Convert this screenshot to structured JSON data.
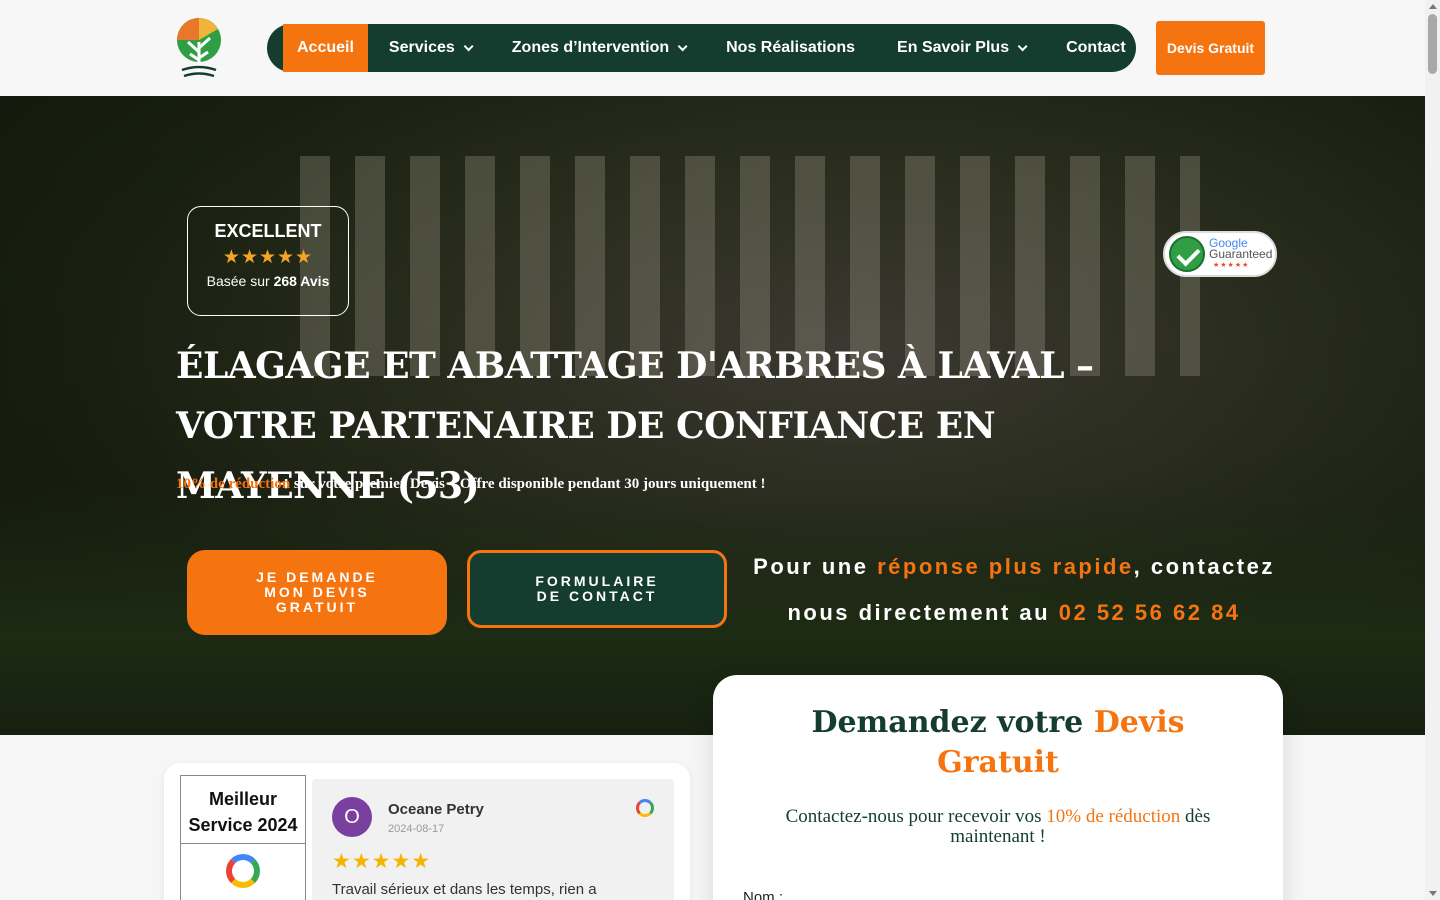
{
  "header": {
    "nav": [
      {
        "label": "Accueil",
        "active": true,
        "dropdown": false
      },
      {
        "label": "Services",
        "dropdown": true
      },
      {
        "label": "Zones d’Intervention",
        "dropdown": true
      },
      {
        "label": "Nos Réalisations",
        "dropdown": false
      },
      {
        "label": "En Savoir Plus",
        "dropdown": true
      },
      {
        "label": "Contact",
        "dropdown": false
      }
    ],
    "devis_button": "Devis Gratuit"
  },
  "hero": {
    "rating": {
      "label": "EXCELLENT",
      "stars": "★★★★★",
      "based_prefix": "Basée sur",
      "based_count": "268 Avis"
    },
    "google_badge": {
      "line1": "Google",
      "line2": "Guaranteed",
      "stars": "★★★★★"
    },
    "title": "Élagage et abattage d'arbres à Laval – Votre partenaire de confiance en Mayenne (53)",
    "promo": {
      "accent": "10% de réduction",
      "rest": " sur votre premier Devis – Offre disponible pendant 30 jours uniquement !"
    },
    "cta_primary": "JE DEMANDE MON DEVIS GRATUIT",
    "cta_secondary": "FORMULAIRE DE CONTACT",
    "contact": {
      "part1": "Pour une ",
      "accent1": "réponse plus rapide",
      "part2": ", contactez nous directement au ",
      "phone": "02 52 56 62 84"
    }
  },
  "reviews": {
    "best_service": "Meilleur Service 2024",
    "review": {
      "avatar_initial": "O",
      "name": "Oceane Petry",
      "date": "2024-08-17",
      "stars": "★★★★★",
      "text": "Travail sérieux et dans les temps, rien a"
    }
  },
  "quote_form": {
    "title_part1": "Demandez votre ",
    "title_accent": "Devis Gratuit",
    "sub_part1": "Contactez-nous pour recevoir vos ",
    "sub_accent": "10% de réduction",
    "sub_part2": " dès maintenant !",
    "field_label": "Nom :"
  },
  "colors": {
    "accent": "#f57410",
    "dark_green": "#143d2f"
  }
}
